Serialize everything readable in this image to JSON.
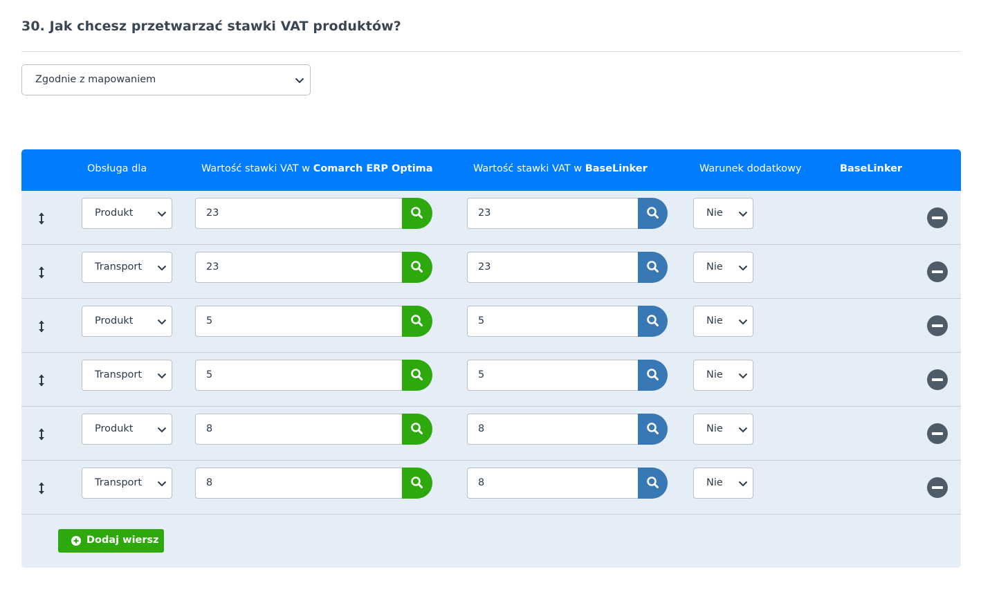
{
  "question": "30. Jak chcesz przetwarzać stawki VAT produktów?",
  "mode_select": {
    "value": "Zgodnie z mapowaniem",
    "icon": "chevron-down-icon"
  },
  "table": {
    "headers": {
      "handling": "Obsługa dla",
      "erp_prefix": "Wartość stawki VAT w ",
      "erp_bold": "Comarch ERP Optima",
      "bl_prefix": "Wartość stawki VAT w ",
      "bl_bold": "BaseLinker",
      "condition": "Warunek dodatkowy",
      "baselinker": "BaseLinker"
    },
    "rows": [
      {
        "type": "Produkt",
        "erp_value": "23",
        "bl_value": "23",
        "condition": "Nie"
      },
      {
        "type": "Transport",
        "erp_value": "23",
        "bl_value": "23",
        "condition": "Nie"
      },
      {
        "type": "Produkt",
        "erp_value": "5",
        "bl_value": "5",
        "condition": "Nie"
      },
      {
        "type": "Transport",
        "erp_value": "5",
        "bl_value": "5",
        "condition": "Nie"
      },
      {
        "type": "Produkt",
        "erp_value": "8",
        "bl_value": "8",
        "condition": "Nie"
      },
      {
        "type": "Transport",
        "erp_value": "8",
        "bl_value": "8",
        "condition": "Nie"
      }
    ],
    "add_row_label": "Dodaj wiersz"
  },
  "colors": {
    "header_bg": "#007cff",
    "table_bg": "#e5eef7",
    "erp_search": "#2da90d",
    "bl_search": "#3878b5",
    "remove": "#4e5b69",
    "add_button": "#2da90d"
  }
}
